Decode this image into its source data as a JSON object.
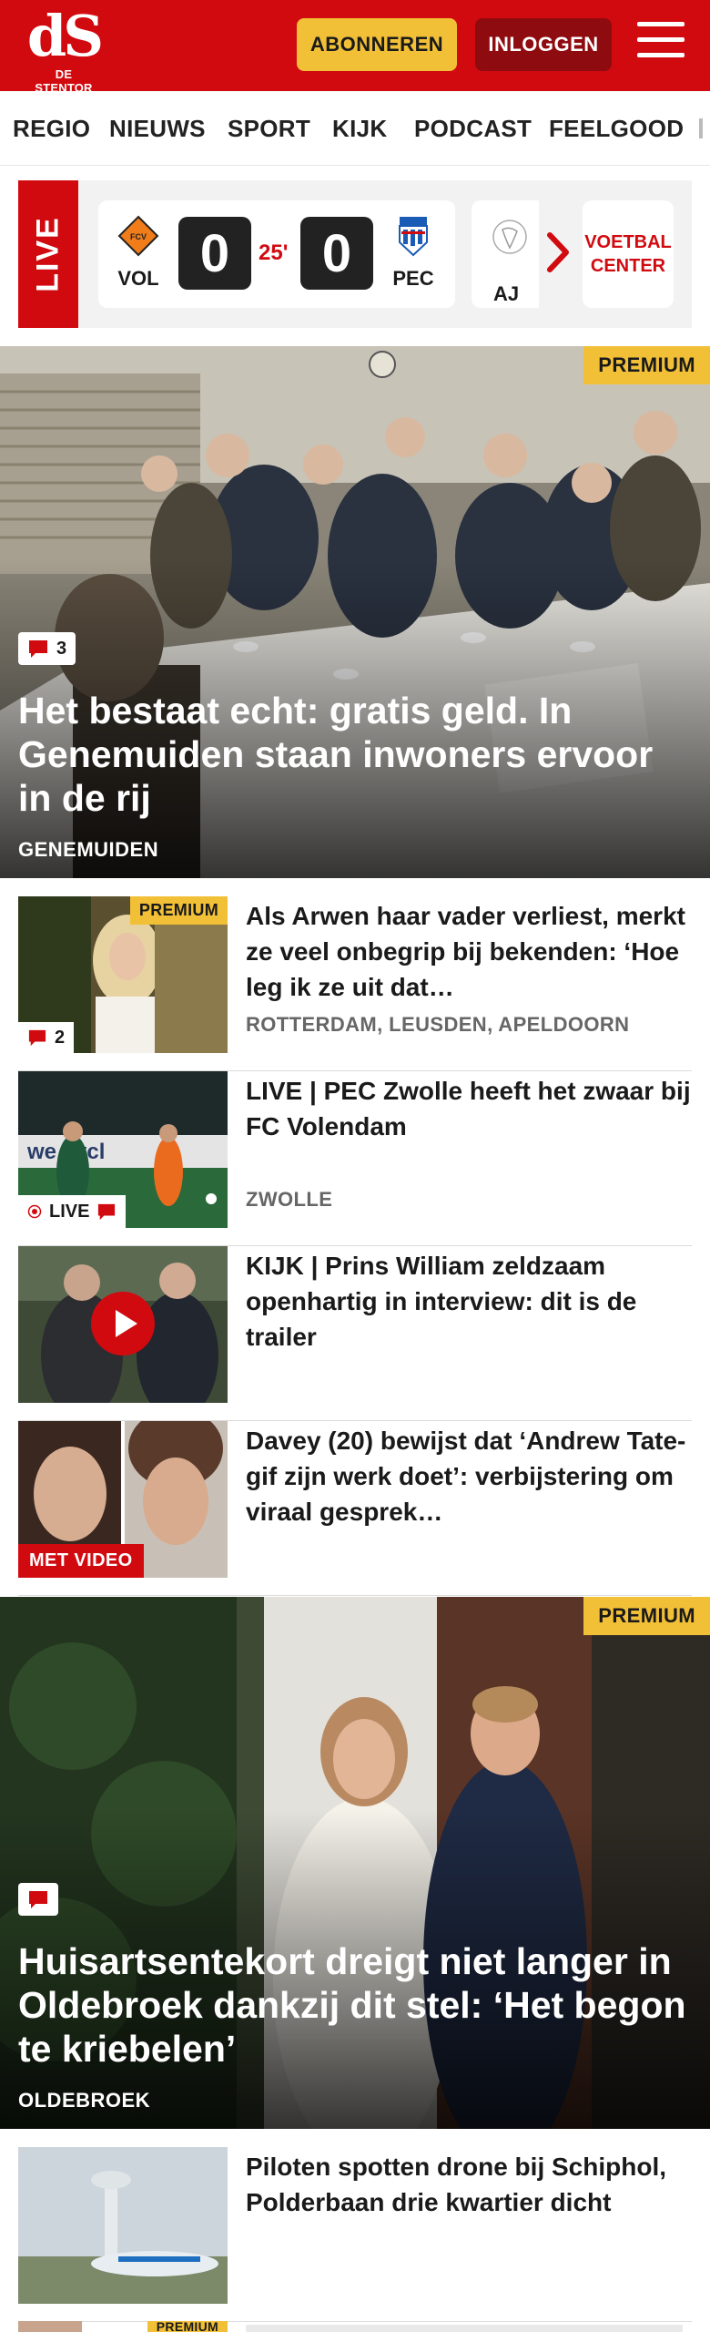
{
  "header": {
    "logo_mark": "dS",
    "logo_name": "DE STENTOR",
    "subscribe_label": "ABONNEREN",
    "login_label": "INLOGGEN",
    "brand_color": "#d10a10"
  },
  "nav": {
    "items": [
      "REGIO",
      "NIEUWS",
      "SPORT",
      "KIJK",
      "PODCAST",
      "FEELGOOD"
    ]
  },
  "live_bar": {
    "tag": "LIVE",
    "match": {
      "home": "VOL",
      "home_score": "0",
      "minute": "25'",
      "away_score": "0",
      "away": "PEC"
    },
    "next_team": "AJ",
    "voetbal_center": "VOETBAL CENTER"
  },
  "hero1": {
    "premium": "PREMIUM",
    "comments": "3",
    "title": "Het bestaat echt: gratis geld. In Genemuiden staan inwoners ervoor in de rij",
    "location": "GENEMUIDEN"
  },
  "articles": [
    {
      "premium": "PREMIUM",
      "comments": "2",
      "title": "Als Arwen haar vader verliest, merkt ze veel onbegrip bij bekenden: ‘Hoe leg ik ze uit dat…",
      "location": "ROTTERDAM, LEUSDEN, APELDOORN"
    },
    {
      "live": "LIVE",
      "title": "LIVE | PEC Zwolle heeft het zwaar bij FC Volendam",
      "location": "ZWOLLE"
    },
    {
      "title": "KIJK | Prins William zeldzaam openhartig in interview: dit is de trailer"
    },
    {
      "video": "MET VIDEO",
      "title": "Davey (20) bewijst dat ‘Andrew Tate-gif zijn werk doet’: verbijstering om viraal gesprek…"
    }
  ],
  "hero2": {
    "premium": "PREMIUM",
    "title": "Huisartsentekort dreigt niet langer in Oldebroek dankzij dit stel: ‘Het begon te kriebelen’",
    "location": "OLDEBROEK"
  },
  "article_last": {
    "title": "Piloten spotten drone bij Schiphol, Polderbaan drie kwartier dicht"
  },
  "article_partial": {
    "premium": "PREMIUM"
  }
}
